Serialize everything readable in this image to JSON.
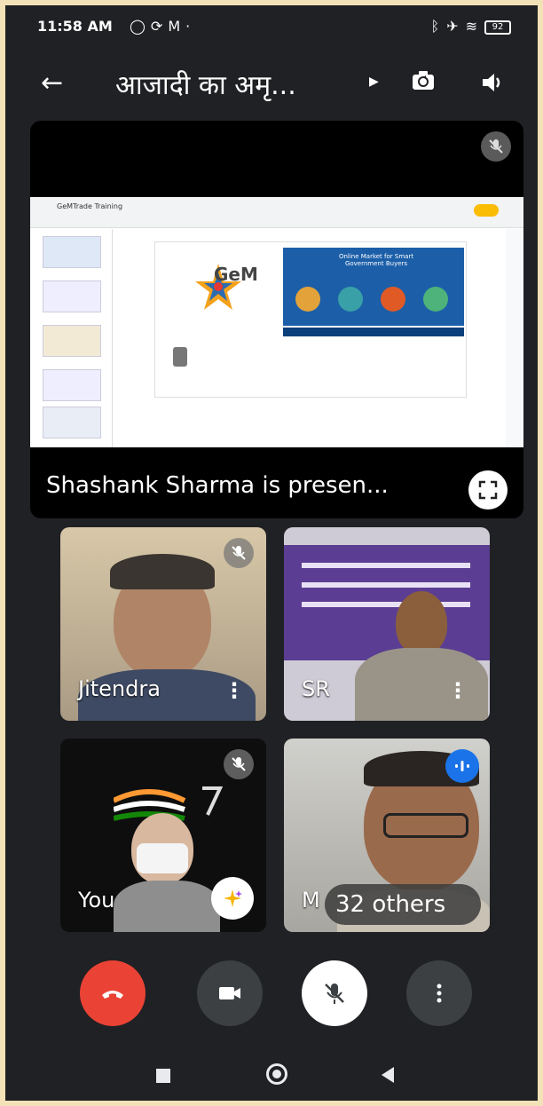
{
  "status_bar": {
    "time": "11:58 AM",
    "left_icons": [
      "whatsapp-icon",
      "sync-icon",
      "gmail-icon"
    ],
    "right_icons": [
      "bluetooth-icon",
      "airplane-icon",
      "wifi-icon",
      "battery-icon"
    ],
    "battery": "92"
  },
  "app_bar": {
    "title": "आजादी का अमृ...",
    "actions": [
      "switch-camera-icon",
      "speaker-icon"
    ]
  },
  "presentation": {
    "presenter_text": "Shashank Sharma is presen...",
    "slide": {
      "deck_name": "GeMTrade Training",
      "logo_text": "GeM",
      "banner_text": "Online Market for Smart Government Buyers"
    }
  },
  "participants": [
    {
      "name": "Jitendra",
      "muted": true
    },
    {
      "name": "SR",
      "muted": false
    },
    {
      "name": "You",
      "muted": true
    },
    {
      "name": "M",
      "speaking": true
    }
  ],
  "others_chip": "32 others",
  "controls": [
    "end-call",
    "camera",
    "microphone-muted",
    "more-options"
  ],
  "colors": {
    "background": "#202124",
    "end_call": "#ea4335",
    "control": "#3c4043",
    "speaking": "#1a73e8",
    "frame": "#f3e2b8"
  }
}
